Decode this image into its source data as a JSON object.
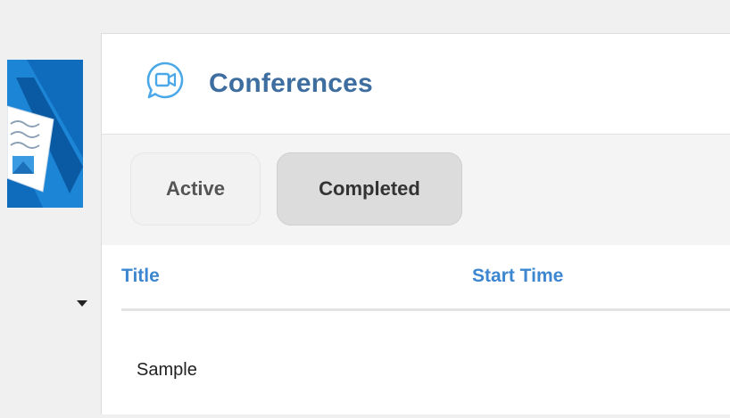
{
  "header": {
    "title": "Conferences",
    "icon": "video-chat-icon",
    "accent_color": "#4aa8e8",
    "title_color": "#3e6d9f"
  },
  "tabs": [
    {
      "label": "Active",
      "selected": false
    },
    {
      "label": "Completed",
      "selected": true
    }
  ],
  "table": {
    "columns": [
      "Title",
      "Start Time"
    ],
    "rows": [
      {
        "title": "Sample",
        "start_time": ""
      }
    ]
  },
  "sidebar": {
    "logo": "app-logo",
    "dropdown_icon": "caret-down-icon",
    "brand_color": "#0f6cbd"
  }
}
